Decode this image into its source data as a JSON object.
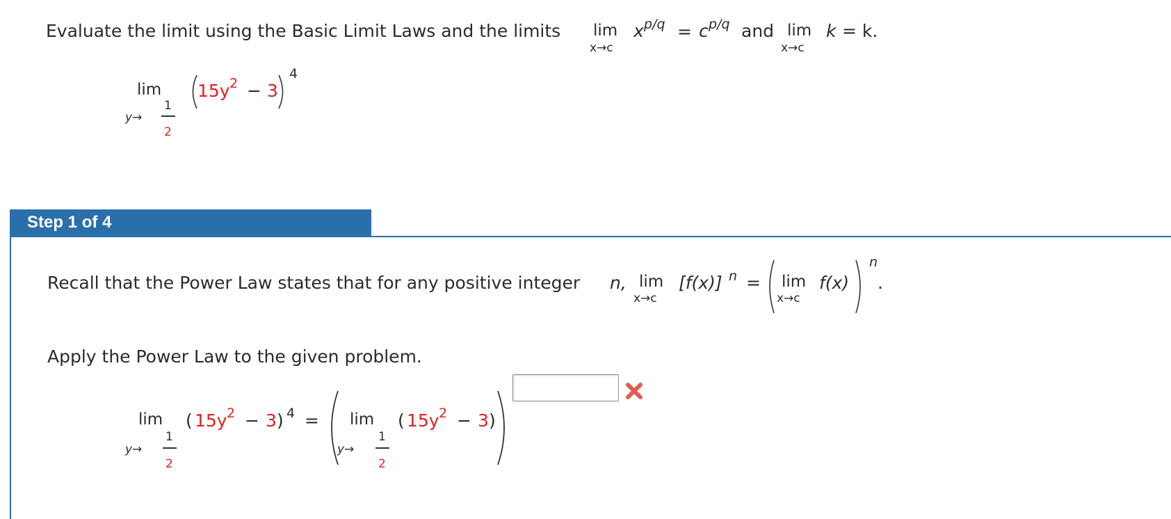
{
  "problem": {
    "intro": "Evaluate the limit using the Basic Limit Laws and the limits",
    "lim": "lim",
    "x_to_c": "x→c",
    "law1_base": "x",
    "law1_exp": "p/q",
    "eq": "=",
    "law1_rhs_base": "c",
    "law1_rhs_exp": "p/q",
    "and": "and",
    "law2_var": "k",
    "law2_rhs": "= k.",
    "limit_lim": "lim",
    "y_arrow": "y→",
    "frac_num": "1",
    "frac_den": "2",
    "expr_coeff": "15y",
    "expr_sq": "2",
    "expr_minus": "−",
    "expr_const": "3",
    "expr_power": "4"
  },
  "step": {
    "label": "Step 1 of 4",
    "recall_text": "Recall that the Power Law states that for any positive integer",
    "recall_var": "n,",
    "lim": "lim",
    "x_to_c": "x→c",
    "lhs": "[f(x)]",
    "lhs_exp": "n",
    "eq": "=",
    "rhs_inner": "f(x)",
    "rhs_exp": "n",
    "period": ".",
    "apply_text": "Apply the Power Law to the given problem.",
    "lim_y": "y→",
    "frac_num": "1",
    "frac_den": "2",
    "open_paren": "(",
    "close_paren": ")",
    "coeff": "15y",
    "sq": "2",
    "minus": "−",
    "const": "3",
    "power": "4",
    "answer_value": "",
    "answer_status": "incorrect"
  },
  "colors": {
    "accent": "#2a6faa",
    "highlight": "#e3201b",
    "text": "#2b2b2b"
  }
}
